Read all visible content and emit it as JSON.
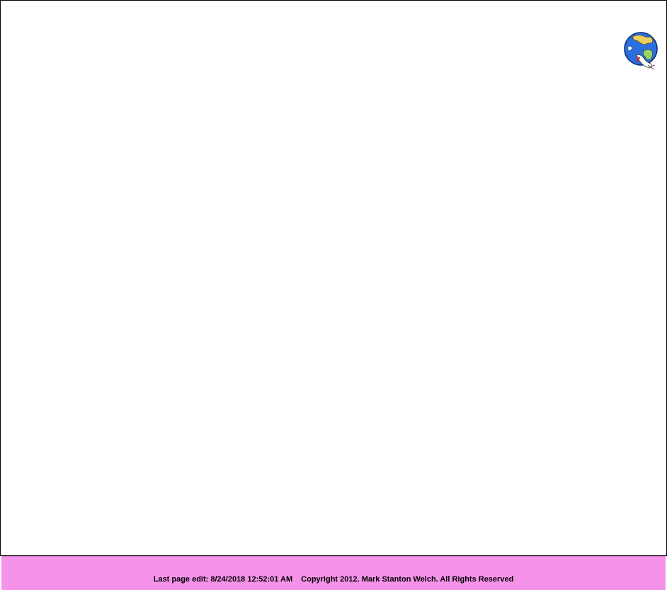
{
  "logo": {
    "icon": "globe-dove-icon",
    "colors": {
      "ocean": "#2a6fe0",
      "land": "#e8e070",
      "cloud": "#ffffff",
      "accent": "#e02020"
    }
  },
  "footer": {
    "last_edit": "Last page edit: 8/24/2018 12:52:01 AM",
    "copyright": "Copyright 2012. Mark Stanton Welch. All Rights Reserved",
    "background": "#f592ea"
  }
}
